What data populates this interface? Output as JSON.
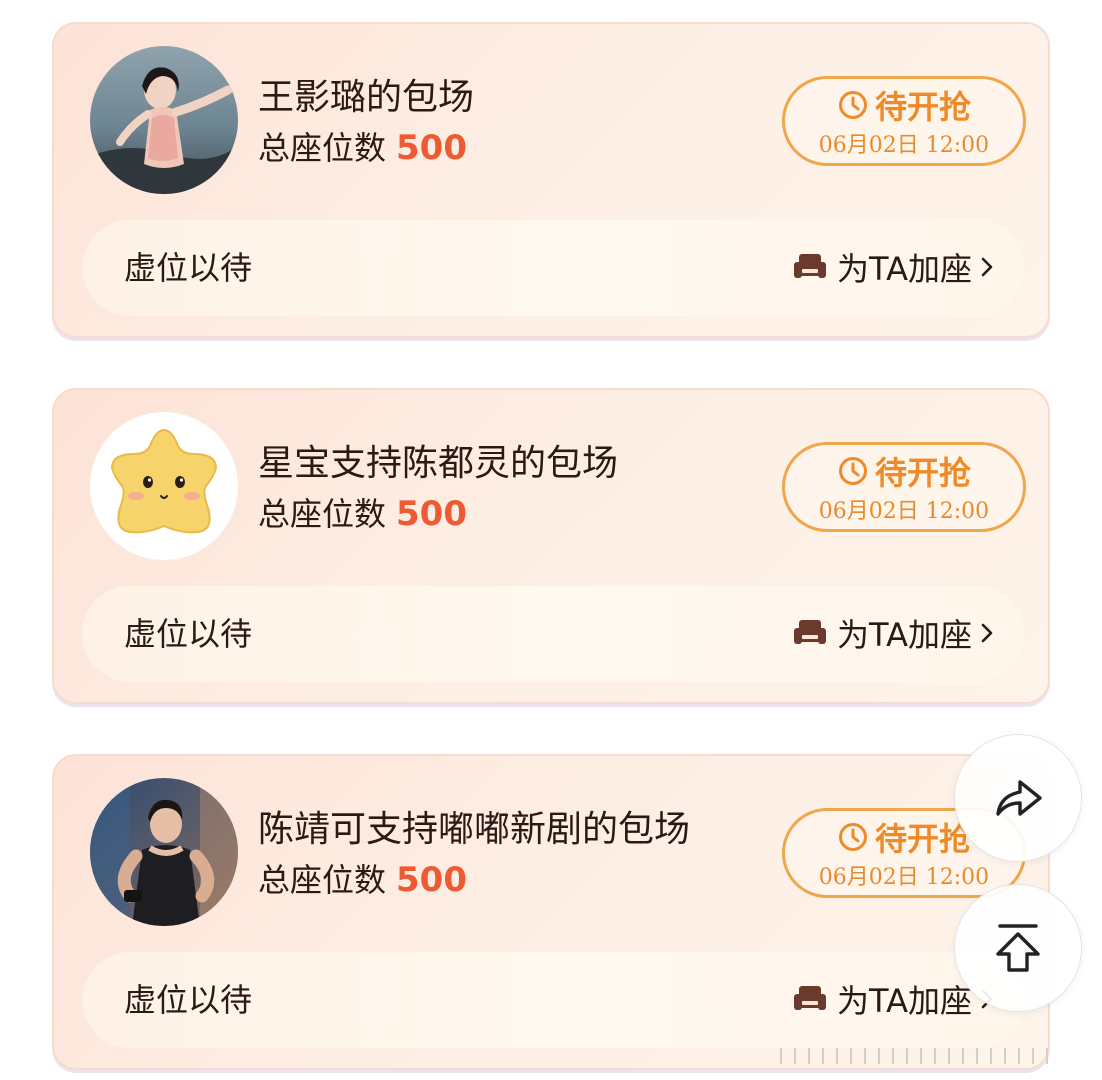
{
  "cards": [
    {
      "title": "王影璐的包场",
      "seats_label": "总座位数",
      "seats_count": "500",
      "status_label": "待开抢",
      "status_time": "06月02日 12:00",
      "empty_label": "虚位以待",
      "add_seat_label": "为TA加座",
      "avatar_icon": "woman-portrait-avatar"
    },
    {
      "title": "星宝支持陈都灵的包场",
      "seats_label": "总座位数",
      "seats_count": "500",
      "status_label": "待开抢",
      "status_time": "06月02日 12:00",
      "empty_label": "虚位以待",
      "add_seat_label": "为TA加座",
      "avatar_icon": "star-mascot-avatar"
    },
    {
      "title": "陈靖可支持嘟嘟新剧的包场",
      "seats_label": "总座位数",
      "seats_count": "500",
      "status_label": "待开抢",
      "status_time": "06月02日 12:00",
      "empty_label": "虚位以待",
      "add_seat_label": "为TA加座",
      "avatar_icon": "man-portrait-avatar"
    }
  ],
  "floating_buttons": {
    "share_icon": "share-arrow-icon",
    "top_icon": "back-to-top-icon"
  },
  "colors": {
    "accent_orange": "#ee8b28",
    "count_red": "#ee5a32",
    "text_dark": "#2b1a14",
    "pill_border": "#f0a64a"
  }
}
